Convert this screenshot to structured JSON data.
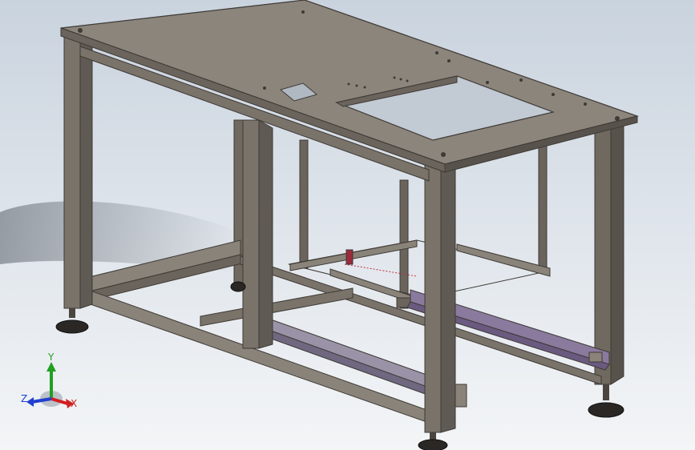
{
  "viewport": {
    "background_top": "#c9d3de",
    "background_bottom": "#f3f5f7"
  },
  "model": {
    "steel_color": "#7a736a",
    "steel_dark": "#4a4540",
    "steel_light": "#9a938a",
    "rail_color": "#8a7a9e",
    "sensor_color": "#9c2a3c"
  },
  "triad": {
    "x_label": "X",
    "y_label": "Y",
    "z_label": "Z",
    "x_color": "#d02020",
    "y_color": "#20a020",
    "z_color": "#2040d0"
  }
}
